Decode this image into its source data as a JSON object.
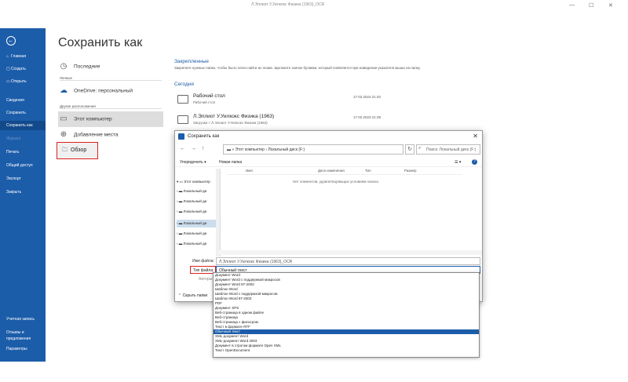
{
  "window": {
    "title": "Л.Эллиот У.Уилкокс Физика (1963)_OCR",
    "ctl_min": "—",
    "ctl_max": "☐",
    "ctl_close": "✕"
  },
  "sidebar": {
    "back": "←",
    "items": [
      {
        "label": "Главная",
        "icon": "⌂"
      },
      {
        "label": "Создать",
        "icon": "▢"
      },
      {
        "label": "Открыть",
        "icon": "▭"
      },
      {
        "label": "Сведения",
        "icon": ""
      },
      {
        "label": "Сохранить",
        "icon": ""
      },
      {
        "label": "Сохранить как",
        "icon": ""
      },
      {
        "label": "Журнал",
        "icon": ""
      },
      {
        "label": "Печать",
        "icon": ""
      },
      {
        "label": "Общий доступ",
        "icon": ""
      },
      {
        "label": "Экспорт",
        "icon": ""
      },
      {
        "label": "Закрыть",
        "icon": ""
      }
    ],
    "bottom": [
      {
        "label": "Учетная запись"
      },
      {
        "label": "Отзывы и предложения"
      },
      {
        "label": "Параметры"
      }
    ]
  },
  "page_title": "Сохранить как",
  "locations": {
    "recent": "Последние",
    "personal_header": "Личные",
    "onedrive": "OneDrive: персональный",
    "other_header": "Другие расположения",
    "this_pc": "Этот компьютер",
    "add_place": "Добавление места",
    "browse": "Обзор"
  },
  "pinned": {
    "title": "Закрепленные",
    "desc": "Закрепите нужные папки, чтобы было легко найти их позже. Щелкните значок булавки, который появляется при наведении указателя мыши на папку."
  },
  "today": {
    "title": "Сегодня",
    "items": [
      {
        "name": "Рабочий стол",
        "path": "Рабочий стол",
        "date": "17.02.2023 21:40"
      },
      {
        "name": "Л.Эллиот У.Уилкокс Физика (1963)",
        "path": "Загрузки » Л.Эллиот У.Уилкокс Физика (1963)",
        "date": "17.02.2023 21:39"
      }
    ]
  },
  "dialog": {
    "title": "Сохранить как",
    "close": "✕",
    "back": "←",
    "forward": "→",
    "up": "↑",
    "address": "▬  » Этот компьютер  ›  Локальный диск (F:)",
    "refresh": "↻",
    "search_placeholder": "Поиск: Локальный диск (F:)",
    "toolbar": {
      "organize": "Упорядочить ▾",
      "new_folder": "Новая папка",
      "view": "☰ ▾",
      "help": "?"
    },
    "tree": [
      {
        "label": "Этот компьютер",
        "selected": false
      },
      {
        "label": "Локальный ди",
        "selected": false
      },
      {
        "label": "Локальный ди",
        "selected": false
      },
      {
        "label": "Локальный ди",
        "selected": false
      },
      {
        "label": "Локальный ди",
        "selected": true
      },
      {
        "label": "Локальный ди",
        "selected": false
      },
      {
        "label": "Локальный ди",
        "selected": false
      }
    ],
    "columns": [
      "Имя",
      "Дата изменения",
      "Тип",
      "Размер"
    ],
    "empty_text": "Нет элементов, удовлетворяющих условиям поиска.",
    "filename_label": "Имя файла:",
    "filename_value": "Л.Эллиот У.Уилкокс Физика (1963)_OCR",
    "filetype_label": "Тип файла:",
    "filetype_value": "Обычный текст",
    "authors_label": "Авторы:",
    "hide_folders": "Скрыть папки",
    "filetype_options": [
      "Документ Word",
      "Документ Word с поддержкой макросов",
      "Документ Word 97-2003",
      "Шаблон Word",
      "Шаблон Word с поддержкой макросов",
      "Шаблон Word 97-2003",
      "PDF",
      "Документ XPS",
      "Веб-страница в одном файле",
      "Веб-страница",
      "Веб-страница с фильтром",
      "Текст в формате RTF",
      "Обычный текст",
      "XML-документ Word",
      "XML-документ Word 2003",
      "Документ в строгом формате Open XML",
      "Текст OpenDocument"
    ],
    "selected_option_index": 12
  }
}
